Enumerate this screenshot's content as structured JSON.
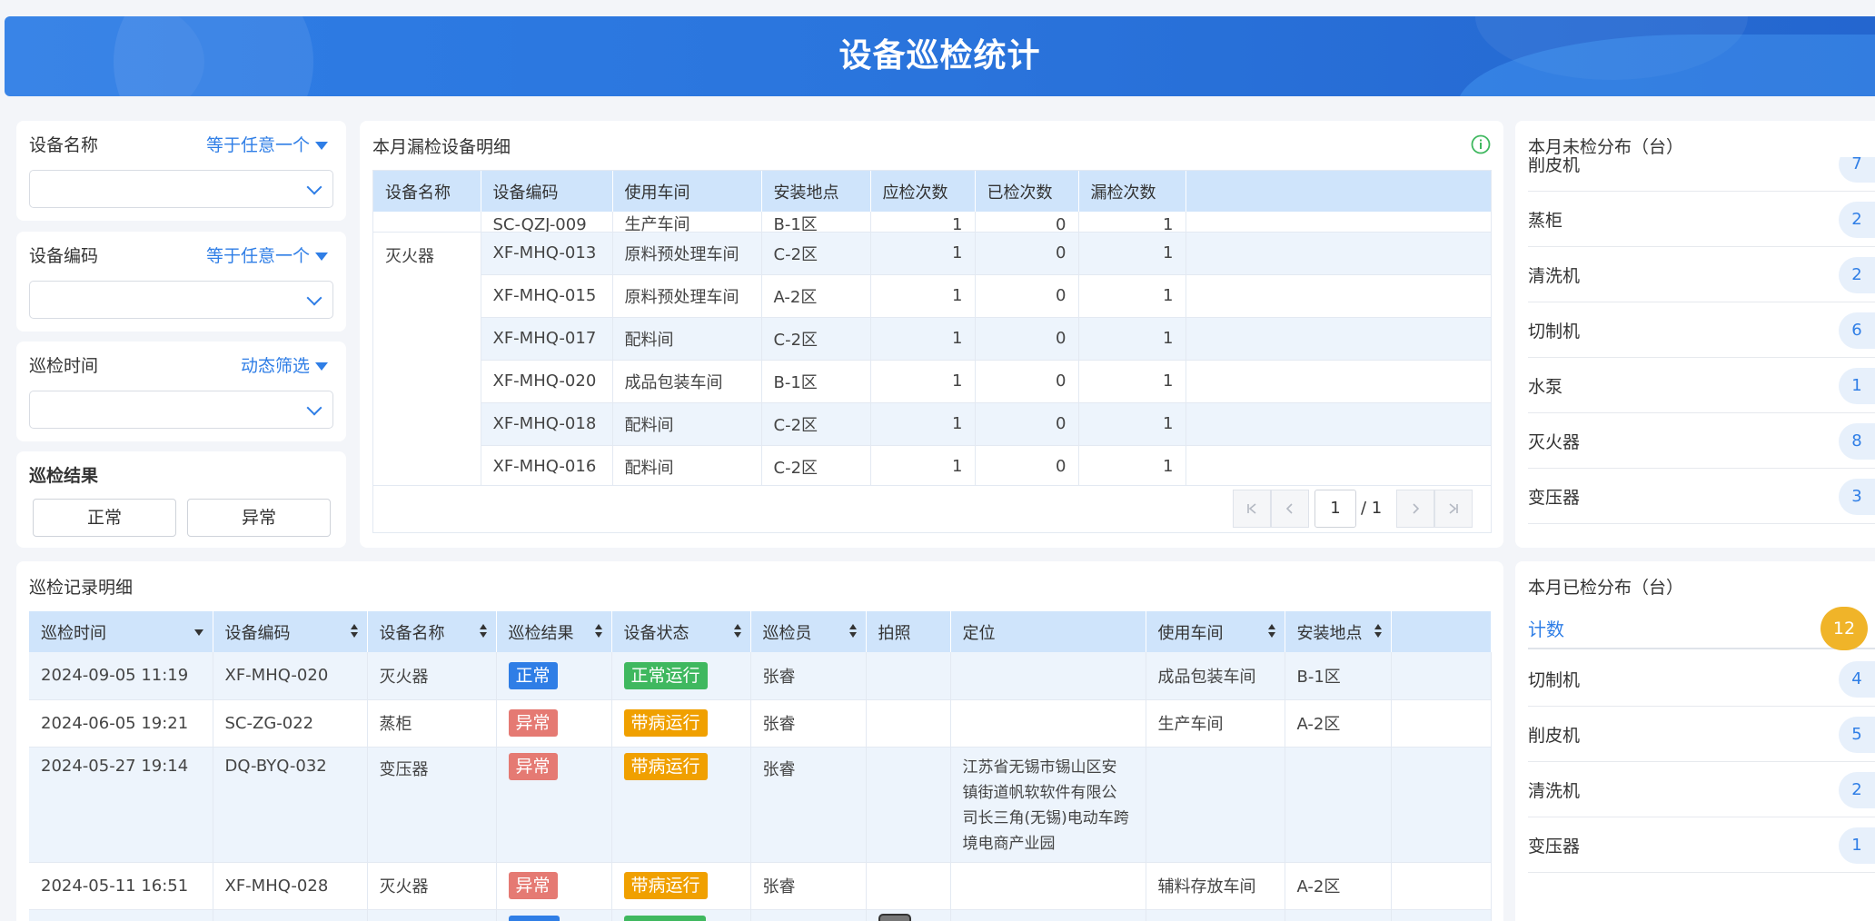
{
  "header": {
    "title": "设备巡检统计"
  },
  "filters": {
    "equipment_name": {
      "label": "设备名称",
      "op": "等于任意一个",
      "value": ""
    },
    "equipment_code": {
      "label": "设备编码",
      "op": "等于任意一个",
      "value": ""
    },
    "inspection_time": {
      "label": "巡检时间",
      "op": "动态筛选",
      "value": ""
    },
    "result": {
      "label": "巡检结果",
      "options": [
        "正常",
        "异常"
      ]
    }
  },
  "missed": {
    "title": "本月漏检设备明细",
    "columns": [
      "设备名称",
      "设备编码",
      "使用车间",
      "安装地点",
      "应检次数",
      "已检次数",
      "漏检次数"
    ],
    "partial_row": {
      "code": "SC-QZJ-009",
      "workshop": "生产车间",
      "location": "B-1区",
      "due": "1",
      "done": "0",
      "missed": "1"
    },
    "group_name": "灭火器",
    "rows": [
      {
        "code": "XF-MHQ-013",
        "workshop": "原料预处理车间",
        "location": "C-2区",
        "due": "1",
        "done": "0",
        "missed": "1"
      },
      {
        "code": "XF-MHQ-015",
        "workshop": "原料预处理车间",
        "location": "A-2区",
        "due": "1",
        "done": "0",
        "missed": "1"
      },
      {
        "code": "XF-MHQ-017",
        "workshop": "配料间",
        "location": "C-2区",
        "due": "1",
        "done": "0",
        "missed": "1"
      },
      {
        "code": "XF-MHQ-020",
        "workshop": "成品包装车间",
        "location": "B-1区",
        "due": "1",
        "done": "0",
        "missed": "1"
      },
      {
        "code": "XF-MHQ-018",
        "workshop": "配料间",
        "location": "C-2区",
        "due": "1",
        "done": "0",
        "missed": "1"
      },
      {
        "code": "XF-MHQ-016",
        "workshop": "配料间",
        "location": "C-2区",
        "due": "1",
        "done": "0",
        "missed": "1"
      }
    ],
    "pager": {
      "first": "⏮",
      "prev": "‹",
      "current": "1",
      "total": "/ 1",
      "next": "›",
      "last": "⏭"
    }
  },
  "unchecked": {
    "title": "本月未检分布（台）",
    "items": [
      {
        "label": "削皮机",
        "count": "7"
      },
      {
        "label": "蒸柜",
        "count": "2"
      },
      {
        "label": "清洗机",
        "count": "2"
      },
      {
        "label": "切制机",
        "count": "6"
      },
      {
        "label": "水泵",
        "count": "1"
      },
      {
        "label": "灭火器",
        "count": "8"
      },
      {
        "label": "变压器",
        "count": "3"
      }
    ]
  },
  "records": {
    "title": "巡检记录明细",
    "columns": [
      "巡检时间",
      "设备编码",
      "设备名称",
      "巡检结果",
      "设备状态",
      "巡检员",
      "拍照",
      "定位",
      "使用车间",
      "安装地点"
    ],
    "rows": [
      {
        "time": "2024-09-05 11:19",
        "code": "XF-MHQ-020",
        "name": "灭火器",
        "result": "正常",
        "status": "正常运行",
        "inspector": "张睿",
        "photo": "",
        "location": "",
        "workshop": "成品包装车间",
        "place": "B-1区"
      },
      {
        "time": "2024-06-05 19:21",
        "code": "SC-ZG-022",
        "name": "蒸柜",
        "result": "异常",
        "status": "带病运行",
        "inspector": "张睿",
        "photo": "",
        "location": "",
        "workshop": "生产车间",
        "place": "A-2区"
      },
      {
        "time": "2024-05-27 19:14",
        "code": "DQ-BYQ-032",
        "name": "变压器",
        "result": "异常",
        "status": "带病运行",
        "inspector": "张睿",
        "photo": "",
        "location_lines": [
          "江苏省无锡市锡山区安",
          "镇街道帆软软件有限公",
          "司长三角(无锡)电动车跨",
          "境电商产业园"
        ],
        "workshop": "",
        "place": ""
      },
      {
        "time": "2024-05-11 16:51",
        "code": "XF-MHQ-028",
        "name": "灭火器",
        "result": "异常",
        "status": "带病运行",
        "inspector": "张睿",
        "photo": "",
        "location": "",
        "workshop": "辅料存放车间",
        "place": "A-2区"
      }
    ]
  },
  "checked": {
    "title": "本月已检分布（台）",
    "total_label": "计数",
    "total": "12",
    "items": [
      {
        "label": "切制机",
        "count": "4"
      },
      {
        "label": "削皮机",
        "count": "5"
      },
      {
        "label": "清洗机",
        "count": "2"
      },
      {
        "label": "变压器",
        "count": "1"
      }
    ]
  },
  "colors": {
    "accent": "#2f7ee6",
    "header_bg": "#cfe4fb",
    "normal": "#2f7ee6",
    "abnormal": "#e57a73",
    "running": "#3fb85f",
    "sick": "#f0a000",
    "total_badge": "#f0b429"
  }
}
